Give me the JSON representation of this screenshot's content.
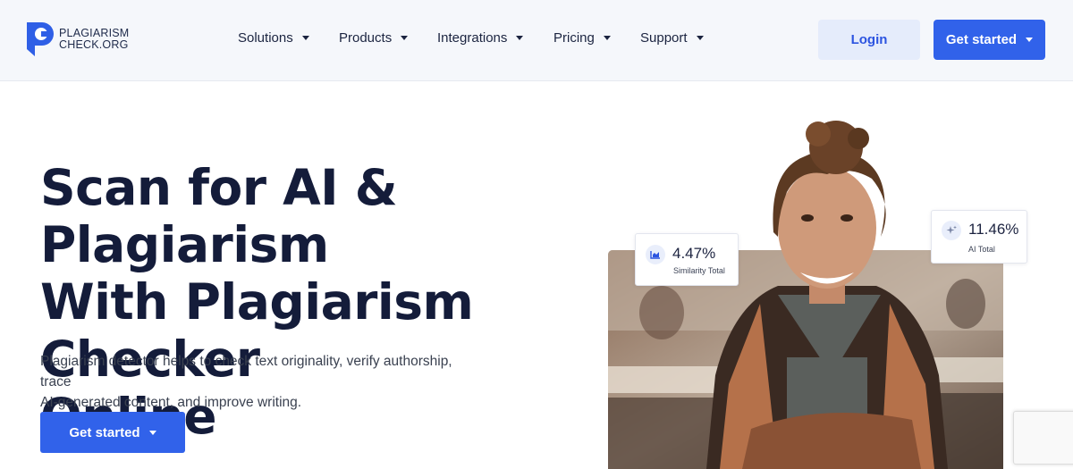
{
  "header": {
    "logo": {
      "line1": "PLAGIARISM",
      "line2": "CHECK.ORG",
      "icon": "logo-p-icon"
    },
    "nav": [
      {
        "label": "Solutions"
      },
      {
        "label": "Products"
      },
      {
        "label": "Integrations"
      },
      {
        "label": "Pricing"
      },
      {
        "label": "Support"
      }
    ],
    "login_label": "Login",
    "get_started_label": "Get started"
  },
  "hero": {
    "title_lines": [
      "Scan for AI & Plagiarism",
      "With Plagiarism Checker",
      "Online"
    ],
    "subtitle_line1": "Plagiarism detector helps to check text originality, verify authorship, trace",
    "subtitle_line2": "AI-generated content, and improve writing.",
    "cta_label": "Get started"
  },
  "stats": {
    "similarity": {
      "value": "4.47%",
      "label": "Similarity Total",
      "icon": "chart-icon"
    },
    "ai": {
      "value": "11.46%",
      "label": "AI Total",
      "icon": "sparkle-icon"
    }
  },
  "colors": {
    "accent": "#3162ea",
    "header_bg": "#f5f7fb",
    "login_bg": "#e5ecfb",
    "title": "#141c3a"
  }
}
